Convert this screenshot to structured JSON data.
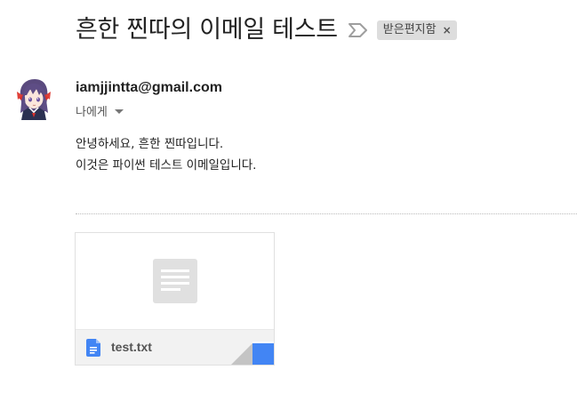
{
  "message": {
    "subject": "흔한 찐따의 이메일 테스트",
    "label": "받은편지함",
    "label_close": "×",
    "sender_email": "iamjjintta@gmail.com",
    "recipient": "나에게",
    "body_lines": [
      "안녕하세요, 흔한 찐따입니다.",
      "이것은 파이썬 테스트 이메일입니다."
    ]
  },
  "attachment": {
    "filename": "test.txt",
    "icon": "google-docs-icon",
    "accent_color": "#4285f4"
  },
  "icons": {
    "importance": "importance-marker-icon",
    "recipient_menu": "caret-down-icon",
    "avatar": "anime-avatar"
  }
}
